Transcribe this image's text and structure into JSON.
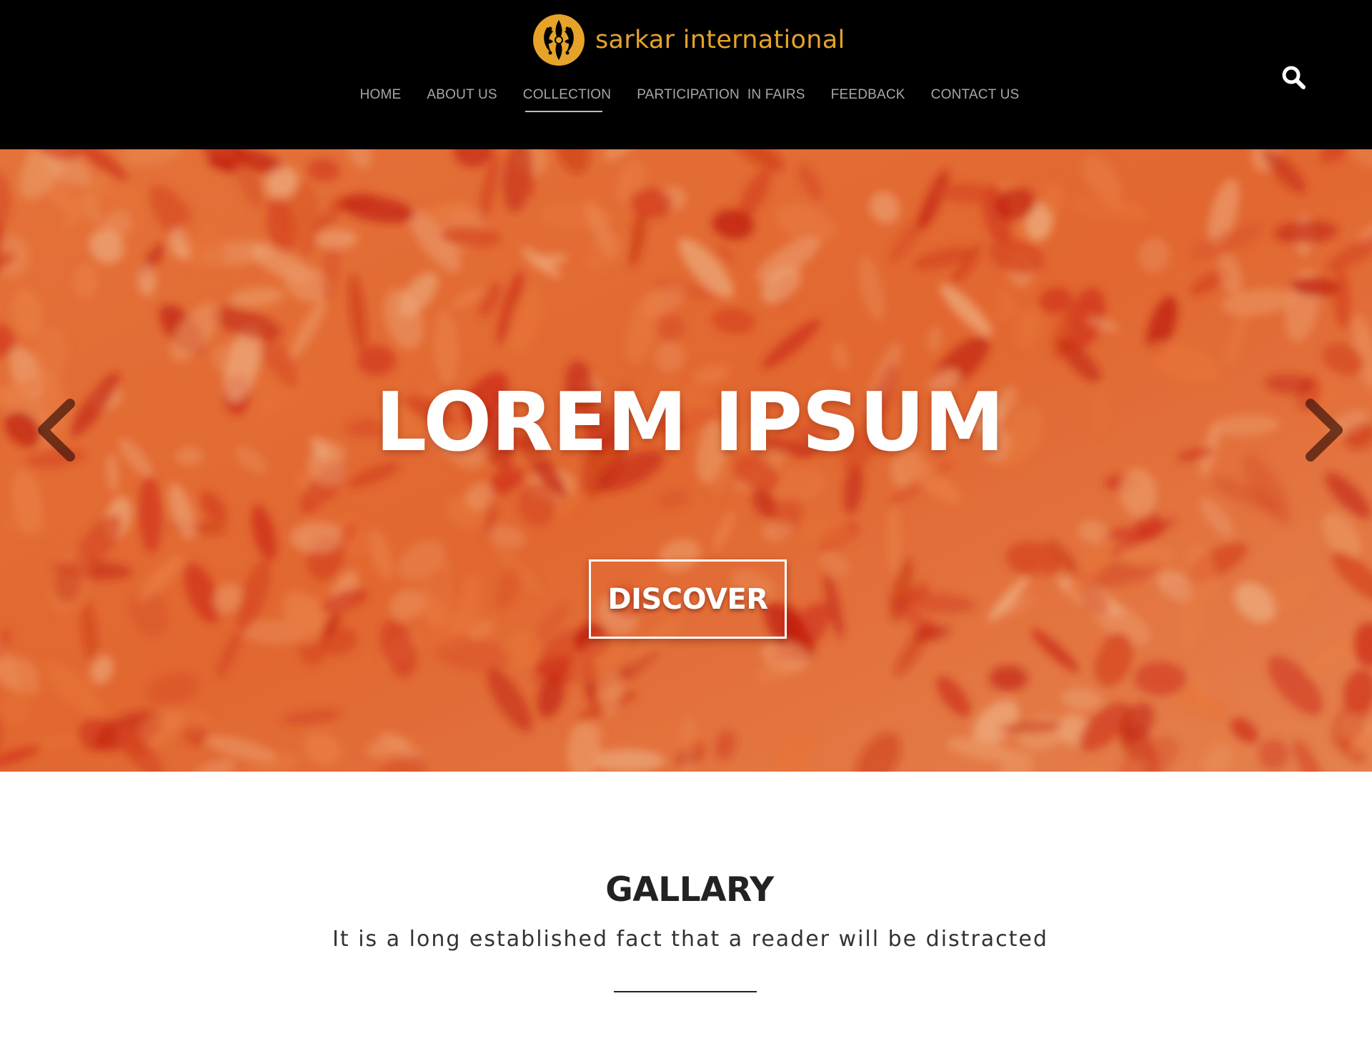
{
  "header": {
    "brand_name": "sarkar international",
    "brand_color": "#e6a32a",
    "logo_icon": "ornamental-swirl-logo-icon",
    "search_icon": "search-icon",
    "nav": [
      {
        "label": "HOME",
        "active": false
      },
      {
        "label": "ABOUT US",
        "active": false
      },
      {
        "label": "COLLECTION",
        "active": true
      },
      {
        "label": "PARTICIPATION  IN FAIRS",
        "active": false
      },
      {
        "label": "FEEDBACK",
        "active": false
      },
      {
        "label": "CONTACT US",
        "active": false
      }
    ]
  },
  "hero": {
    "title": "LOREM IPSUM",
    "button_label": "DISCOVER",
    "prev_icon": "chevron-left-icon",
    "next_icon": "chevron-right-icon",
    "image_description_colors": [
      "#f27a3a",
      "#d12a10",
      "#f7a070"
    ]
  },
  "gallery": {
    "title": "GALLARY",
    "subtitle": "It is a long established fact that a reader will be distracted"
  }
}
